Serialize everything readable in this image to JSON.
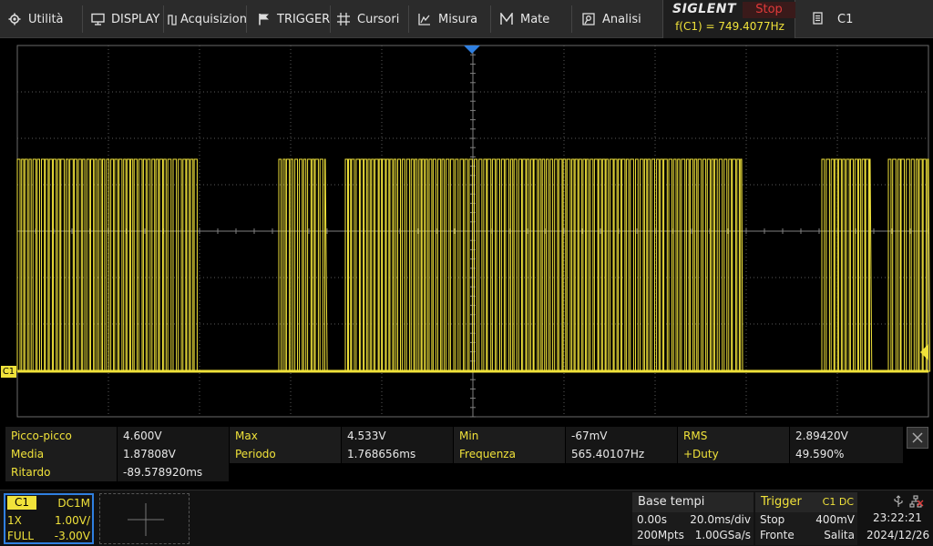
{
  "menu": {
    "utility": "Utilità",
    "display": "DISPLAY",
    "acquisition": "Acquisizione",
    "trigger": "TRIGGER",
    "cursors": "Cursori",
    "measure": "Misura",
    "math": "Mate",
    "analysis": "Analisi"
  },
  "brand": {
    "logo": "SIGLENT",
    "run_state": "Stop",
    "freq_readout": "f(C1) = 749.4077Hz",
    "run_state_color": "#e03a3a"
  },
  "channel_tab": {
    "label": "C1"
  },
  "scope": {
    "channel_marker": "C1",
    "trace_color": "#f0e23a",
    "grid_color": "#5a5a5a",
    "trigger_marker_color": "#2f7fe0"
  },
  "measurements": [
    {
      "label": "Picco-picco",
      "value": "4.600V"
    },
    {
      "label": "Max",
      "value": "4.533V"
    },
    {
      "label": "Min",
      "value": "-67mV"
    },
    {
      "label": "RMS",
      "value": "2.89420V"
    },
    {
      "label": "Media",
      "value": "1.87808V"
    },
    {
      "label": "Periodo",
      "value": "1.768656ms"
    },
    {
      "label": "Frequenza",
      "value": "565.40107Hz"
    },
    {
      "label": "+Duty",
      "value": "49.590%"
    },
    {
      "label": "Ritardo",
      "value": "-89.578920ms"
    }
  ],
  "channel_box": {
    "name": "C1",
    "coupling": "DC1M",
    "probe": "1X",
    "scale": "1.00V/",
    "bandwidth": "FULL",
    "offset": "-3.00V"
  },
  "timebase": {
    "title": "Base tempi",
    "delay": "0.00s",
    "scale": "20.0ms/div",
    "memory": "200Mpts",
    "sample_rate": "1.00GSa/s"
  },
  "trigger": {
    "title": "Trigger",
    "source": "C1 DC",
    "mode": "Stop",
    "level": "400mV",
    "type": "Fronte",
    "slope": "Salita"
  },
  "clock": {
    "time": "23:22:21",
    "date": "2024/12/26"
  }
}
